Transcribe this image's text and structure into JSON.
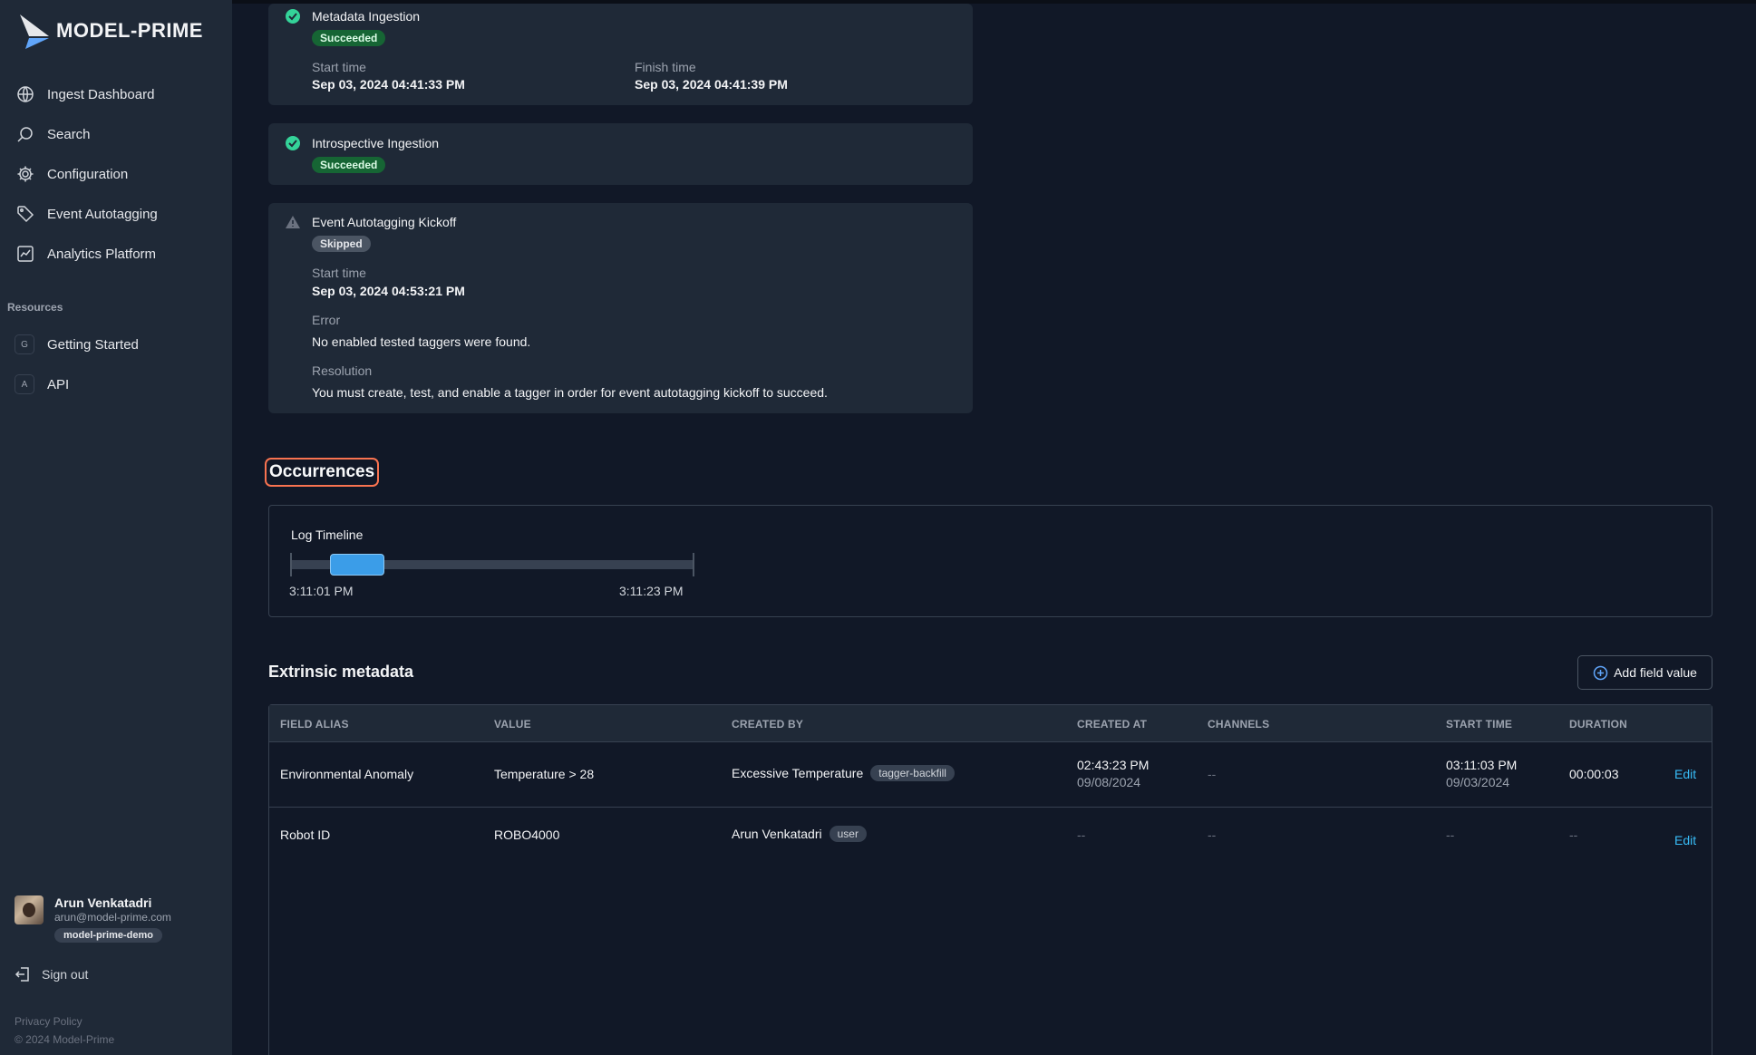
{
  "brand": {
    "name": "MODEL-PRIME"
  },
  "nav": [
    {
      "label": "Ingest Dashboard",
      "icon": "globe-icon"
    },
    {
      "label": "Search",
      "icon": "search-icon"
    },
    {
      "label": "Configuration",
      "icon": "gear-icon"
    },
    {
      "label": "Event Autotagging",
      "icon": "tag-icon"
    },
    {
      "label": "Analytics Platform",
      "icon": "chart-icon"
    }
  ],
  "resources": {
    "title": "Resources",
    "items": [
      {
        "letter": "G",
        "label": "Getting Started"
      },
      {
        "letter": "A",
        "label": "API"
      }
    ]
  },
  "user": {
    "name": "Arun Venkatadri",
    "email": "arun@model-prime.com",
    "org": "model-prime-demo"
  },
  "sign_out": "Sign out",
  "footer": {
    "privacy": "Privacy Policy",
    "copyright": "© 2024 Model-Prime"
  },
  "steps": {
    "metadata": {
      "title": "Metadata Ingestion",
      "status": "Succeeded",
      "start_label": "Start time",
      "start": "Sep 03, 2024 04:41:33 PM",
      "finish_label": "Finish time",
      "finish": "Sep 03, 2024 04:41:39 PM"
    },
    "introspective": {
      "title": "Introspective Ingestion",
      "status": "Succeeded"
    },
    "kickoff": {
      "title": "Event Autotagging Kickoff",
      "status": "Skipped",
      "start_label": "Start time",
      "start": "Sep 03, 2024 04:53:21 PM",
      "error_label": "Error",
      "error": "No enabled tested taggers were found.",
      "resolution_label": "Resolution",
      "resolution": "You must create, test, and enable a tagger in order for event autotagging kickoff to succeed."
    }
  },
  "occurrences": {
    "title": "Occurrences",
    "timeline": {
      "label": "Log Timeline",
      "start": "3:11:01 PM",
      "end": "3:11:23 PM"
    }
  },
  "extrinsic": {
    "title": "Extrinsic metadata",
    "add_button": "Add field value",
    "columns": [
      "FIELD ALIAS",
      "VALUE",
      "CREATED BY",
      "CREATED AT",
      "CHANNELS",
      "START TIME",
      "DURATION"
    ],
    "rows": [
      {
        "alias": "Environmental Anomaly",
        "value": "Temperature > 28",
        "created_by": "Excessive Temperature",
        "created_by_tag": "tagger-backfill",
        "created_at_time": "02:43:23 PM",
        "created_at_date": "09/08/2024",
        "channels": "--",
        "start_time": "03:11:03 PM",
        "start_date": "09/03/2024",
        "duration": "00:00:03",
        "action": "Edit"
      },
      {
        "alias": "Robot ID",
        "value": "ROBO4000",
        "created_by": "Arun Venkatadri",
        "created_by_tag": "user",
        "created_at": "--",
        "channels": "--",
        "start_time": "--",
        "duration": "--",
        "action": "Edit"
      }
    ]
  }
}
